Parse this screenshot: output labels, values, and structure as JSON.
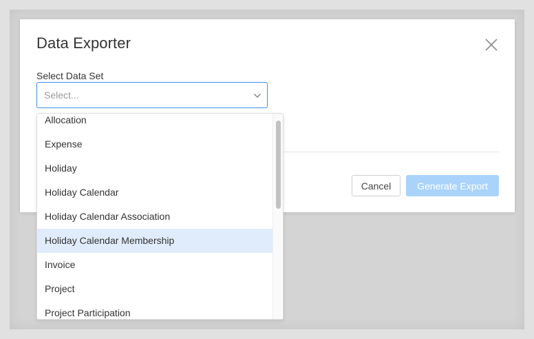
{
  "dialog": {
    "title": "Data Exporter",
    "close_icon": "close-icon"
  },
  "field": {
    "label": "Select Data Set",
    "placeholder": "Select...",
    "chevron_icon": "chevron-down-icon",
    "focus_color": "#3f8ee6"
  },
  "buttons": {
    "cancel": "Cancel",
    "generate": "Generate Export",
    "generate_color": "#a9d3fb"
  },
  "dropdown": {
    "highlight_color": "#e0ecfc",
    "options": [
      "Allocation",
      "Expense",
      "Holiday",
      "Holiday Calendar",
      "Holiday Calendar Association",
      "Holiday Calendar Membership",
      "Invoice",
      "Project",
      "Project Participation"
    ],
    "highlighted_option": "Holiday Calendar Membership"
  }
}
